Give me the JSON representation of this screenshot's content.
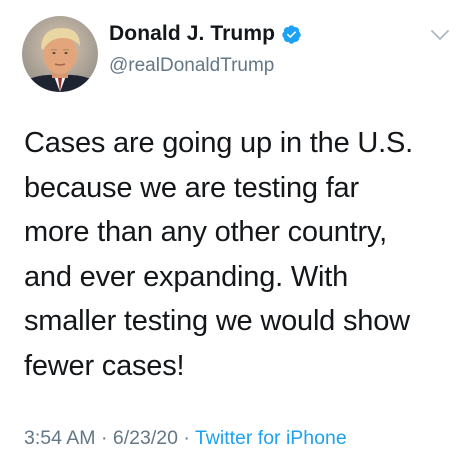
{
  "user": {
    "display_name": "Donald J. Trump",
    "handle": "@realDonaldTrump",
    "verified": true
  },
  "tweet": {
    "text": "Cases are going up in the U.S.\nbecause we are testing far\nmore than any other country,\nand ever expanding. With\nsmaller testing we would show\nfewer cases!",
    "time": "3:54 AM",
    "date": "6/23/20",
    "separator": "·",
    "source": "Twitter for iPhone"
  },
  "icons": {
    "verified": "verified-badge-icon",
    "caret": "chevron-down-icon"
  },
  "colors": {
    "text": "#14171a",
    "secondary": "#657786",
    "accent": "#1da1f2"
  }
}
